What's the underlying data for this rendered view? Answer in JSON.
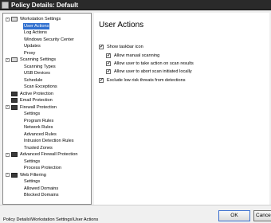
{
  "window": {
    "title": "Policy Details: Default"
  },
  "tree": {
    "items": [
      {
        "label": "Workstation Settings",
        "level": 0,
        "icon": "computer-icon",
        "expander": "-"
      },
      {
        "label": "User Actions",
        "level": 1,
        "selected": true
      },
      {
        "label": "Log Actions",
        "level": 1
      },
      {
        "label": "Windows Security Center",
        "level": 1
      },
      {
        "label": "Updates",
        "level": 1
      },
      {
        "label": "Proxy",
        "level": 1
      },
      {
        "label": "Scanning Settings",
        "level": 0,
        "icon": "scan-icon",
        "expander": "-"
      },
      {
        "label": "Scanning Types",
        "level": 1
      },
      {
        "label": "USB Devices",
        "level": 1
      },
      {
        "label": "Schedule",
        "level": 1
      },
      {
        "label": "Scan Exceptions",
        "level": 1
      },
      {
        "label": "Active Protection",
        "level": 0,
        "icon": "shield-icon"
      },
      {
        "label": "Email Protection",
        "level": 0,
        "icon": "email-icon"
      },
      {
        "label": "Firewall Protection",
        "level": 0,
        "icon": "firewall-icon",
        "expander": "-"
      },
      {
        "label": "Settings",
        "level": 1
      },
      {
        "label": "Program Rules",
        "level": 1
      },
      {
        "label": "Network Rules",
        "level": 1
      },
      {
        "label": "Advanced Rules",
        "level": 1
      },
      {
        "label": "Intrusion Detection Rules",
        "level": 1
      },
      {
        "label": "Trusted Zones",
        "level": 1
      },
      {
        "label": "Advanced Firewall Protection",
        "level": 0,
        "icon": "firewall-icon",
        "expander": "-"
      },
      {
        "label": "Settings",
        "level": 1
      },
      {
        "label": "Process Protection",
        "level": 1
      },
      {
        "label": "Web Filtering",
        "level": 0,
        "icon": "web-icon",
        "expander": "-"
      },
      {
        "label": "Settings",
        "level": 1
      },
      {
        "label": "Allowed Domains",
        "level": 1
      },
      {
        "label": "Blocked Domains",
        "level": 1
      }
    ]
  },
  "content": {
    "title": "User Actions",
    "options": [
      {
        "label": "Show taskbar icon",
        "checked": true,
        "level": 0
      },
      {
        "label": "Allow manual scanning",
        "checked": true,
        "level": 1
      },
      {
        "label": "Allow user to take action on scan results",
        "checked": true,
        "level": 1
      },
      {
        "label": "Allow user to abort scan initiated locally",
        "checked": true,
        "level": 1
      },
      {
        "label": "Exclude low risk threats from detections",
        "checked": true,
        "level": 0
      }
    ]
  },
  "status": {
    "path": "Policy Details\\Workstation Settings\\User Actions"
  },
  "buttons": {
    "ok": "OK",
    "cancel": "Cancel"
  },
  "colors": {
    "selection": "#2f6fcf",
    "titlebar": "#2a2a2a"
  }
}
